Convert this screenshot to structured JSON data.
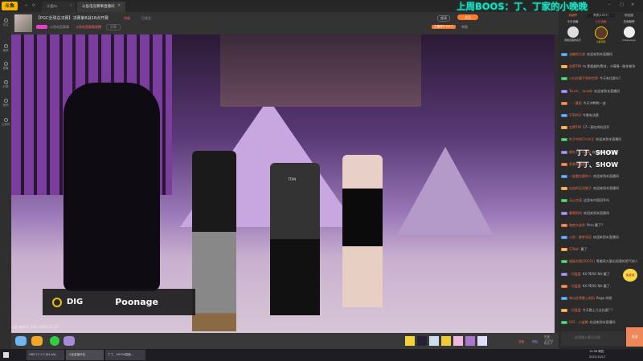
{
  "app": {
    "logo": "斗鱼",
    "accent": "#ff7a2c"
  },
  "topbar": {
    "tabs": [
      {
        "label": "斗鱼tv"
      },
      {
        "label": "斗鱼电竞赛事直播间"
      }
    ],
    "close_tab": "×",
    "overlay_text": "上周BOOS：丁、丁家的小晚晚"
  },
  "header": {
    "room_title": "【PGC全球总决赛】决赛第8战18点开赛",
    "hot": "热度",
    "followers": "已关注",
    "anchor": "斗鱼电竞赛事",
    "category": "斗鱼电竞赛事直播",
    "share": "分享",
    "report": "举报",
    "rank": "主播排行 NO.1",
    "quality": "超清",
    "follow_btn": "关注",
    "fans_badge": "粉丝团",
    "fans_count": "1"
  },
  "sidebar": {
    "items": [
      {
        "label": "关注"
      },
      {
        "label": "推荐"
      },
      {
        "label": "直播"
      },
      {
        "label": "分类"
      },
      {
        "label": "鱼吧"
      },
      {
        "label": "云游戏"
      }
    ]
  },
  "video": {
    "caption_team": "DIG",
    "caption_player": "Poonage",
    "watermark": "斗鱼 房间号: 100 | 2021.12.17",
    "jersey": "TTAN"
  },
  "giftbar": {
    "left_icons": [
      "活动",
      "任务",
      "红包",
      "主播入门"
    ],
    "right": {
      "popularity": "热度 17794",
      "fans": "粉丝 0"
    },
    "actions": [
      "充值",
      "背包"
    ]
  },
  "chat": {
    "tabs": [
      "贡献榜",
      "贵宾(1057)",
      "粉丝团"
    ],
    "rank_tabs": [
      "今日贡献",
      "七日贡献",
      "总贡献榜"
    ],
    "top_users": [
      "观看直播的名字",
      "斗鱼玩家",
      "mikeyesyw"
    ],
    "messages": [
      {
        "user": "油腻的大叔",
        "text": "欢迎来到本直播间"
      },
      {
        "user": "金牌TMI",
        "text": "to 那超越的素材，小晴晴一路伴着你"
      },
      {
        "user": "小白在看不到的世界",
        "text": "今天有比赛么?"
      },
      {
        "user": "Touch、 love你",
        "text": "欢迎来到本直播间"
      },
      {
        "user": "· · · 暮丽",
        "text": "今天冲鸭鸭一波"
      },
      {
        "user": "57BIAO",
        "text": "今晚有决赛"
      },
      {
        "user": "金牌TMI",
        "text": "17一直吃鸡的冠军"
      },
      {
        "user": "豹子中的Circle王",
        "text": "欢迎来到本直播间"
      },
      {
        "user": "柳叶刀 · 12GB",
        "text": "欢迎来到本直播间"
      },
      {
        "user": "多多的路路",
        "text": "~"
      },
      {
        "user": "一起看比赛的人",
        "text": "欢迎来到本直播间"
      },
      {
        "user": "自由的无风猫子",
        "text": "欢迎来到本直播间"
      },
      {
        "user": "无以言表",
        "text": "这里有中国冠军吗"
      },
      {
        "user": "暴晒的码",
        "text": "欢迎来到本直播间"
      },
      {
        "user": "暗夜大逃杀",
        "text": "Pero 赢了?"
      },
      {
        "user": "斗鱼 · 桃梦深深",
        "text": "欢迎来到本直播间"
      },
      {
        "user": "578ah",
        "text": "赢了"
      },
      {
        "user": "超级灰狼(20151)",
        "text": "等着再大量出现我的男气的人"
      },
      {
        "user": "- 问盘盘",
        "text": "KX PERO NH 赢了"
      },
      {
        "user": "- 问盘盘",
        "text": "KX PERO NH 赢了."
      },
      {
        "user": "单山在等晚上的码",
        "text": "Rage 的呢"
      },
      {
        "user": "- 问盘盘",
        "text": "今天晚上几点比赛? ?"
      },
      {
        "user": "925 · 小迷糊",
        "text": "欢迎来到本直播间"
      }
    ],
    "show_banners": [
      "丁丁、SHOW",
      "丁丁、SHOW"
    ],
    "input_placeholder": "这里输入聊天内容",
    "send": "发送",
    "promo": "免费领"
  },
  "taskbar": {
    "apps": [
      "OBS 27.1.3 (64-bit)",
      "斗鱼直播伴侣",
      "丁丁、SHOW直播..."
    ],
    "time": "14:58 周四",
    "date": "2021/12/17"
  }
}
